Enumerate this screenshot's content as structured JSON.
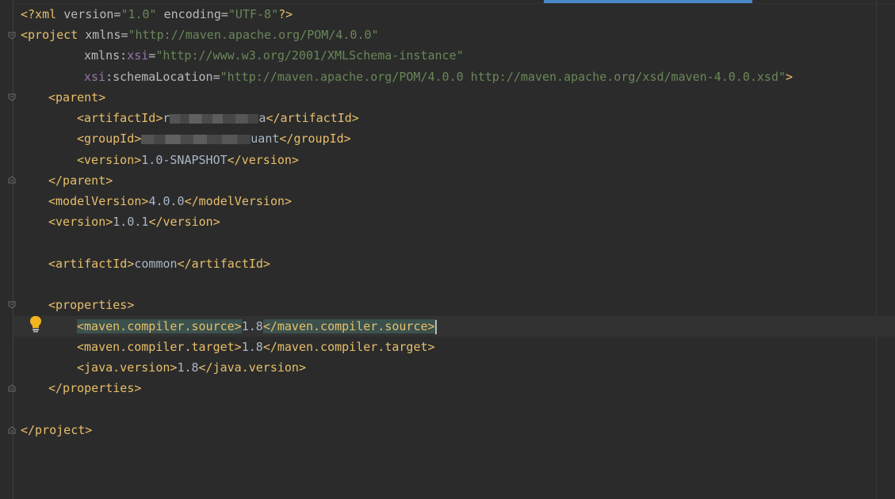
{
  "xml_declaration": {
    "open": "<?xml ",
    "version_attr": "version",
    "version_value": "\"1.0\"",
    "encoding_attr": "encoding",
    "encoding_value": "\"UTF-8\"",
    "close": "?>"
  },
  "project_open": {
    "tag": "<project ",
    "xmlns_attr": "xmlns",
    "xmlns_value": "\"http://maven.apache.org/POM/4.0.0\"",
    "xsi_ns": "xsi",
    "xmlns_xsi_prefix": "xmlns:",
    "xmlns_xsi_value": "\"http://www.w3.org/2001/XMLSchema-instance\"",
    "schema_attr": ":schemaLocation",
    "schema_value": "\"http://maven.apache.org/POM/4.0.0 http://maven.apache.org/xsd/maven-4.0.0.xsd\"",
    "close": ">"
  },
  "parent": {
    "open": "<parent>",
    "close": "</parent>",
    "artifact_open": "<artifactId>",
    "artifact_visible_start": "r",
    "artifact_visible_end": "a",
    "artifact_close": "</artifactId>",
    "group_open": "<groupId>",
    "group_visible_end": "uant",
    "group_close": "</groupId>",
    "version_open": "<version>",
    "version_value": "1.0-SNAPSHOT",
    "version_close": "</version>"
  },
  "model_version": {
    "open": "<modelVersion>",
    "value": "4.0.0",
    "close": "</modelVersion>"
  },
  "version": {
    "open": "<version>",
    "value": "1.0.1",
    "close": "</version>"
  },
  "artifact": {
    "open": "<artifactId>",
    "value": "common",
    "close": "</artifactId>"
  },
  "properties": {
    "open": "<properties>",
    "close": "</properties>",
    "source_open": "<maven.compiler.source>",
    "source_value": "1.8",
    "source_close": "</maven.compiler.source>",
    "target_open": "<maven.compiler.target>",
    "target_value": "1.8",
    "target_close": "</maven.compiler.target>",
    "java_open": "<java.version>",
    "java_value": "1.8",
    "java_close": "</java.version>"
  },
  "project_close": "</project>",
  "colors": {
    "background": "#2b2b2b",
    "tag": "#e8bf6a",
    "attribute": "#bababa",
    "namespace": "#9876aa",
    "string": "#6a8759",
    "text": "#a9b7c6",
    "match_highlight": "#3b514d",
    "current_line": "#323232",
    "accent": "#4a88c7"
  },
  "icons": {
    "intention": "lightbulb-icon",
    "fold": "fold-marker-icon"
  }
}
